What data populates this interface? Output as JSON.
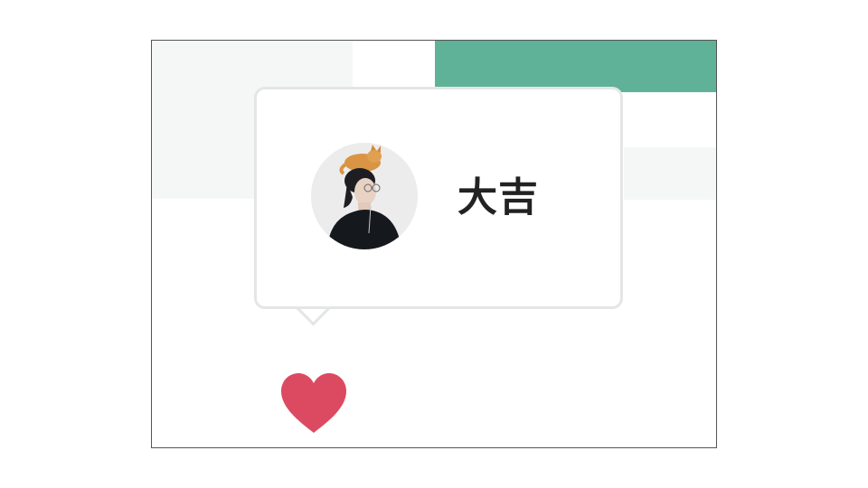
{
  "profile_popover": {
    "user_name": "大吉",
    "avatar_icon": "user-avatar-photo"
  },
  "like_button": {
    "icon": "heart-icon",
    "color": "#db4a60"
  },
  "colors": {
    "accent": "#5fb297",
    "panel": "#f5f7f6",
    "popover_border": "#e4e6e5"
  }
}
